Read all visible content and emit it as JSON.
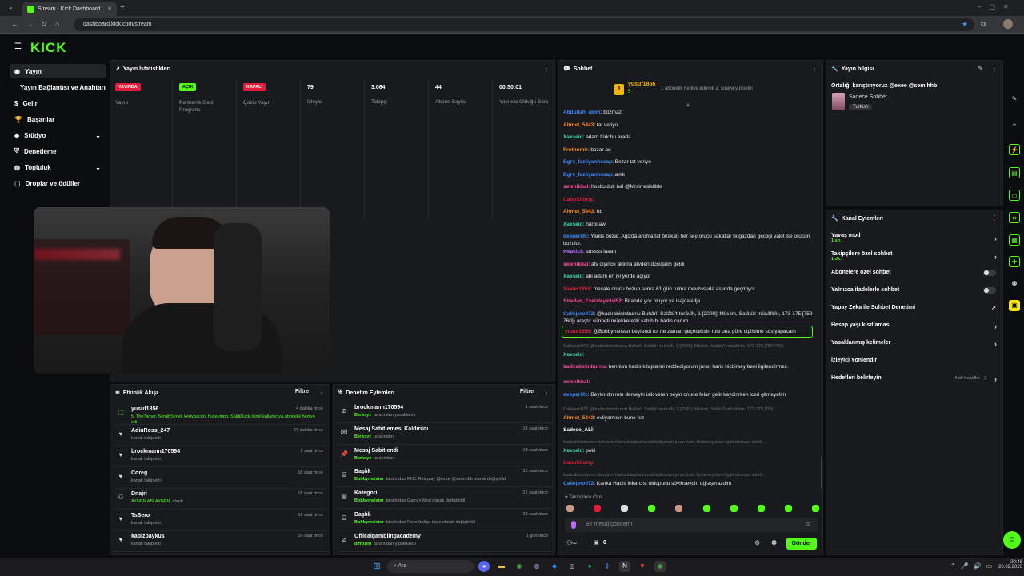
{
  "browser": {
    "tab_title": "Stream - Kick Dashboard",
    "url": "dashboard.kick.com/stream"
  },
  "brand": {
    "logo": "KICK",
    "accent": "#53fc18"
  },
  "sidebar": {
    "items": [
      {
        "label": "Yayın",
        "icon": "broadcast-icon",
        "active": true
      },
      {
        "label": "Yayın Bağlantısı ve Anahtarı",
        "icon": ""
      },
      {
        "label": "Gelir",
        "icon": "money-icon"
      },
      {
        "label": "Başarılar",
        "icon": "trophy-icon"
      },
      {
        "label": "Stüdyo",
        "icon": "studio-icon"
      },
      {
        "label": "Denetleme",
        "icon": "shield-icon"
      },
      {
        "label": "Topluluk",
        "icon": "community-icon"
      },
      {
        "label": "Droplar ve ödüller",
        "icon": "gift-icon"
      }
    ]
  },
  "stats": {
    "title": "Yayın İstatistikleri",
    "cards": [
      {
        "value": "YAYINDA",
        "label": "Yayın",
        "badge": true,
        "color": "#e01e3c"
      },
      {
        "value": "AÇIK",
        "label": "Partnerlik Gelir Programı",
        "badge": true,
        "color": "#53fc18"
      },
      {
        "value": "KAPALI",
        "label": "Çoklu Yayın",
        "badge": true,
        "color": "#e01e3c"
      },
      {
        "value": "79",
        "label": "İzleyici"
      },
      {
        "value": "3.064",
        "label": "Takipçi"
      },
      {
        "value": "44",
        "label": "Abone Sayısı"
      },
      {
        "value": "00:50:01",
        "label": "Yayında Olduğu Süre"
      }
    ]
  },
  "activity": {
    "title": "Etkinlik Akışı",
    "filter": "Filtre",
    "rows": [
      {
        "name": "yusuf1856",
        "sub": "5, TheTamer, SemihSenel, kedybacon, huseyinpq, SaldiDuck isimli kullanıcıya abonelik hediye etti.",
        "time": "4 dakika önce",
        "icon": "gift-icon",
        "subgreen": true
      },
      {
        "name": "AdinRoss_247",
        "sub": "kanalı takip etti",
        "time": "27 dakika önce",
        "icon": "heart-icon"
      },
      {
        "name": "brockmann170594",
        "sub": "kanalı takip etti",
        "time": "2 saat önce",
        "icon": "heart-icon"
      },
      {
        "name": "Coreg",
        "sub": "kanalı takip etti",
        "time": "18 saat önce",
        "icon": "heart-icon"
      },
      {
        "name": "Dnajri",
        "sub": "AYNEN ABİ AYNEN",
        "sub2": "alındı",
        "time": "18 saat önce",
        "icon": "reward-icon"
      },
      {
        "name": "TsSero",
        "sub": "kanalı takip etti",
        "time": "19 saat önce",
        "icon": "heart-icon"
      },
      {
        "name": "kabizbaykus",
        "sub": "kanalı takip etti",
        "time": "20 saat önce",
        "icon": "heart-icon"
      }
    ]
  },
  "moderation": {
    "title": "Denetim Eylemleri",
    "filter": "Filtre",
    "rows": [
      {
        "title": "brockmann170594",
        "by": "Berkxyz",
        "rest": "tarafından yasaklandı",
        "time": "1 saat önce",
        "icon": "ban-icon"
      },
      {
        "title": "Mesaj Sabitlemesi Kaldırıldı",
        "by": "Berkxyz",
        "rest": "tarafından",
        "time": "18 saat önce",
        "icon": "unpin-icon"
      },
      {
        "title": "Mesaj Sabitlendi",
        "by": "Berkxyz",
        "rest": "tarafından",
        "time": "18 saat önce",
        "icon": "pin-icon"
      },
      {
        "title": "Başlık",
        "by": "Bobbymeister",
        "rest": "tarafından RNC Roleplay @exee @semihhb olarak değiştirildi",
        "time": "21 saat önce",
        "icon": "title-icon"
      },
      {
        "title": "Kategori",
        "by": "Bobbymeister",
        "rest": "tarafından Garry's Mod olarak değiştirildi",
        "time": "21 saat önce",
        "icon": "category-icon"
      },
      {
        "title": "Başlık",
        "by": "Bobbymeister",
        "rest": "tarafından Fenerbahçe days olarak değiştirildi",
        "time": "23 saat önce",
        "icon": "title-icon"
      },
      {
        "title": "Officalgamblingacademy",
        "by": "difrozen",
        "rest": "tarafından yasaklandı",
        "time": "1 gün önce",
        "icon": "ban-icon"
      }
    ]
  },
  "chat": {
    "title": "Sohbet",
    "pinned_user": "yusuf1856",
    "pinned_count": "5",
    "pinned_text": "1 abonelik hediye ederek 2. sıraya yükselin",
    "messages": [
      {
        "user": "Abdullah_abim",
        "color": "#3b8bff",
        "text": ": bozmaz"
      },
      {
        "user": "Ahmet_5443",
        "color": "#ff8c1a",
        "text": ": tat veriyo"
      },
      {
        "user": "Xaxseid",
        "color": "#34d8a6",
        "text": ": adam türk bu arada"
      },
      {
        "user": "Frothomir",
        "color": "#ff8c1a",
        "text": ": bozar aq"
      },
      {
        "user": "Bgrv_faziiyanhesap",
        "color": "#3b8bff",
        "text": ": Bozar tat veriyo"
      },
      {
        "user": "Bgrv_faziiyanhesap",
        "color": "#3b8bff",
        "text": ": amk"
      },
      {
        "user": "selenikbal",
        "color": "#ff4fa3",
        "text": ": hosbulduk bal @Mrsirresistible"
      },
      {
        "user": "CanoShorty",
        "color": "#e01e3c",
        "text": ":"
      },
      {
        "user": "Ahmet_5443",
        "color": "#ff8c1a",
        "text": ": hb"
      },
      {
        "user": "Xaxseid",
        "color": "#34d8a6",
        "text": ": harbi aw"
      },
      {
        "user": "deeperiifc",
        "color": "#3b8bff",
        "text": ": Yanlis bozar. Agizda aroma tat birakan her sey orucu sakatlar bogazdan gectigi vakit ise orucun bozulur."
      },
      {
        "user": "weakick",
        "color": "#b86bff",
        "text": ": sussss laaan"
      },
      {
        "user": "selenikbal",
        "color": "#ff4fa3",
        "text": ": atv diyince aklima atvden düşüşüm geldi"
      },
      {
        "user": "Xaxseid",
        "color": "#34d8a6",
        "text": ": abi adam en iyi yerde açıyor"
      },
      {
        "user": "Xavier1855",
        "color": "#e01e3c",
        "text": ": mesale orucu bozup sonra 61 gün tutma mevzusuda aslında geçmiyor"
      },
      {
        "user": "Siradan_Exelzleyicisi52",
        "color": "#ff4fa3",
        "text": ": Biranda yok oluyor ya isajdasidja"
      },
      {
        "user": "Callejero072",
        "color": "#3b8bff",
        "text": ": @kadirabininburnu Buhârî, Salâtü't-terâvîh, 1 [2009]; Müslim, Salâtü'l-müsâfirîn, 173-175 [759-760]) araştır sünneti müekkeredir sahih bi hadis canım"
      },
      {
        "user": "yusuf1856",
        "color": "#e01e3c",
        "text": ": @Bobbymeister beyfendi rol ne zaman geçeceksin role ona göre cipilsime sos yapacam",
        "highlight": true
      },
      {
        "user": "",
        "color": "#777",
        "text": "Callejero072: @kadirabininburnu Buhârî, Salâtü't-terâvîh, 1 [2009]; Müslim, Salâtü'l-müsâfirîn, 173-175 [759-760]...",
        "reply": true
      },
      {
        "user": "Xaxseid",
        "color": "#34d8a6",
        "text": ":"
      },
      {
        "user": "kadirabininburnu",
        "color": "#ff4fa3",
        "text": ": ben tum hadis kitaplarini reddediyorum juran haric hicbirsey beni ilgilendirmez."
      },
      {
        "user": "selenikbal",
        "color": "#ff4fa3",
        "text": ":"
      },
      {
        "user": "deeperiifc",
        "color": "#3b8bff",
        "text": ": Beyler din min demeyin isik veren beyin onune felan gelir kaydirirken iceri gitmeyelim"
      },
      {
        "user": "",
        "color": "#777",
        "text": "Callejero072: @kadirabininburnu Buhârî, Salâtü't-terâvîh, 1 [2009]; Müslim, Salâtü'l-müsâfirîn, 173-175 [759...",
        "reply": true
      },
      {
        "user": "Ahmet_5443",
        "color": "#ff8c1a",
        "text": ": evliyamısın bune hız"
      },
      {
        "user": "Sadece_ALİ",
        "color": "#fff",
        "text": ":"
      },
      {
        "user": "",
        "color": "#777",
        "text": "kadirabininburnu: ben tum hadis kitaplarini reddediyorum juran haric hicbirsey beni ilgilendirmez. isimli ...",
        "reply": true
      },
      {
        "user": "Xaxseid",
        "color": "#34d8a6",
        "text": ": peki"
      },
      {
        "user": "CanoShorty",
        "color": "#e01e3c",
        "text": ":"
      },
      {
        "user": "",
        "color": "#777",
        "text": "kadirabininburnu: ben tum hadis kitaplarini reddediyorum juran haric hicbirsey beni ilgilendirmez. isimli ...",
        "reply": true
      },
      {
        "user": "Callejero072",
        "color": "#3b8bff",
        "text": ": Kanka Hadis inkarcısı oldupunu söyleseydin uğraşmazdım"
      }
    ],
    "followers_only": "Takipçilere Özel",
    "input_placeholder": "Bir mesaj gönderin",
    "points": "0",
    "send": "Gönder"
  },
  "stream_info": {
    "title": "Yayın bilgisi",
    "stream_title": "Ortalığı karıştırıyoruz @exee @semihhb",
    "category": "Sadece Sohbet",
    "tag": "Turkish"
  },
  "channel_actions": {
    "title": "Kanal Eylemleri",
    "items": [
      {
        "label": "Yavaş mod",
        "sub": "1 sn.",
        "control": "chevron"
      },
      {
        "label": "Takipçilere özel sohbet",
        "sub": "1 dk.",
        "control": "chevron"
      },
      {
        "label": "Abonelere özel sohbet",
        "control": "toggle"
      },
      {
        "label": "Yalnızca ifadelerle sohbet",
        "control": "toggle"
      },
      {
        "label": "Yapay Zeka ile Sohbet Denetimi",
        "control": "external"
      },
      {
        "label": "Hesap yaşı kısıtlaması",
        "control": "chevron"
      },
      {
        "label": "Yasaklanmış kelimeler",
        "control": "chevron"
      },
      {
        "label": "İzleyici Yönlendir",
        "control": "none"
      },
      {
        "label": "Hedefleri belirleyin",
        "status": "Aktif hedefler - 2",
        "control": "chevron"
      }
    ]
  },
  "taskbar": {
    "search": "Ara",
    "time": "20:48",
    "date": "20.02.2026"
  }
}
